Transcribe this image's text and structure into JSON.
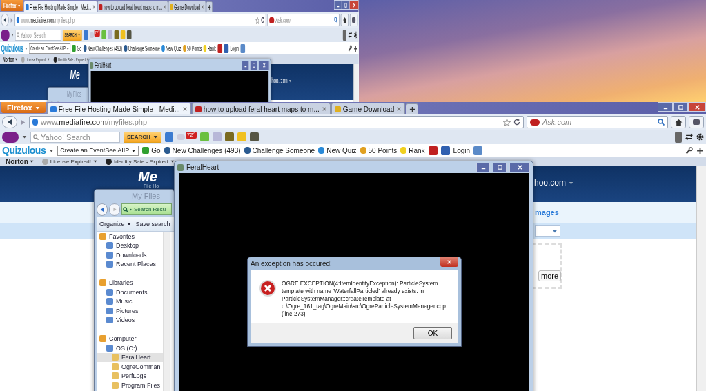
{
  "top_scene": {
    "browser": {
      "menu_button": "Firefox",
      "tabs": [
        {
          "title": "Free File Hosting Made Simple - Medi...",
          "selected": true
        },
        {
          "title": "how to upload feral heart maps to m...",
          "selected": false
        },
        {
          "title": "Game Download",
          "selected": false
        }
      ],
      "url": "www.**mediafire.com**/myfiles.php",
      "search_placeholder": "Ask.com",
      "yahoo": {
        "placeholder": "Yahoo! Search",
        "button": "SEARCH",
        "weather": "72°"
      },
      "quizulous": {
        "brand": "Quizulous",
        "dropdown": "Create an EventSee AIIP",
        "go": "Go",
        "items": [
          "New Challenges (493)",
          "Challenge Someone",
          "New Quiz",
          "50 Points",
          "Rank"
        ],
        "login": "Login"
      },
      "norton": {
        "brand": "Norton",
        "items": [
          "License Expired!",
          "Identity Safe - Expired"
        ]
      }
    },
    "page": {
      "logo": "Me",
      "account": "hoo.com"
    },
    "explorer": {
      "title": "My Files"
    },
    "game_window": {
      "title": "FeralHeart"
    }
  },
  "main_scene": {
    "browser": {
      "menu_button": "Firefox",
      "tabs": [
        {
          "title": "Free File Hosting Made Simple - Medi...",
          "selected": true
        },
        {
          "title": "how to upload feral heart maps to m...",
          "selected": false
        },
        {
          "title": "Game Download",
          "selected": false
        }
      ],
      "url": "www.**mediafire.com**/myfiles.php",
      "search_placeholder": "Ask.com",
      "yahoo": {
        "placeholder": "Yahoo! Search",
        "button": "SEARCH",
        "weather": "72°"
      },
      "quizulous": {
        "brand": "Quizulous",
        "dropdown": "Create an EventSee AIIP",
        "go": "Go",
        "items": [
          "New Challenges (493)",
          "Challenge Someone",
          "New Quiz",
          "50 Points",
          "Rank"
        ],
        "login": "Login"
      },
      "norton": {
        "brand": "Norton",
        "items": [
          "License Expired!",
          "Identity Safe - Expired"
        ]
      }
    },
    "page": {
      "logo": "Me",
      "logo_tagline": "File Ho",
      "account": "hoo.com",
      "images_link": "mages",
      "more_button": "more"
    },
    "explorer": {
      "title": "My Files",
      "search_crumb": "Search Resu",
      "toolbar": [
        "Organize",
        "Save search"
      ],
      "nav": [
        {
          "label": "Favorites",
          "selected": false,
          "children": [
            {
              "label": "Desktop",
              "selected": false
            },
            {
              "label": "Downloads",
              "selected": false
            },
            {
              "label": "Recent Places",
              "selected": false
            }
          ]
        },
        {
          "label": "Libraries",
          "selected": false,
          "children": [
            {
              "label": "Documents",
              "selected": false
            },
            {
              "label": "Music",
              "selected": false
            },
            {
              "label": "Pictures",
              "selected": false
            },
            {
              "label": "Videos",
              "selected": false
            }
          ]
        },
        {
          "label": "Computer",
          "selected": false,
          "children": [
            {
              "label": "OS (C:)",
              "selected": false,
              "children": [
                {
                  "label": "FeralHeart",
                  "selected": true
                },
                {
                  "label": "OgreComman",
                  "selected": false
                },
                {
                  "label": "PerfLogs",
                  "selected": false
                },
                {
                  "label": "Program Files",
                  "selected": false
                }
              ]
            }
          ]
        }
      ]
    },
    "game_window": {
      "title": "FeralHeart"
    },
    "dialog": {
      "title": "An exception has occured!",
      "message": "OGRE EXCEPTION(4:ItemIdentityException): ParticleSystem template with name 'WaterfallParticled' already exists. in ParticleSystemManager::createTemplate at c:\\Ogre_161_tag\\OgreMain\\src\\OgreParticleSystemManager.cpp (line 273)",
      "button": "OK"
    }
  }
}
